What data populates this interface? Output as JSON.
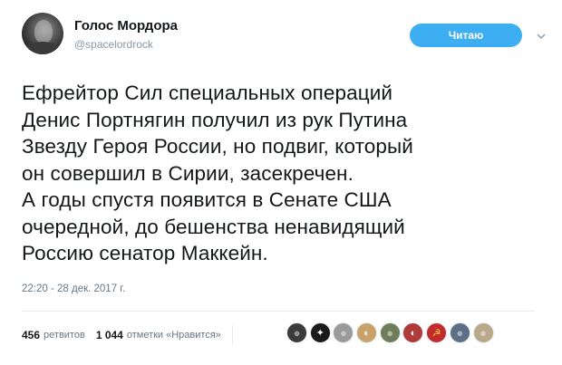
{
  "account": {
    "name": "Голос Мордора",
    "handle": "@spacelordrock",
    "follow_label": "Читаю"
  },
  "tweet": {
    "lines": [
      "Ефрейтор Сил специальных операций",
      "Денис Портнягин получил из рук Путина",
      "Звезду Героя России, но подвиг, который",
      "он совершил в Сирии, засекречен.",
      "А годы спустя появится в Сенате США",
      "очередной, до бешенства ненавидящий",
      "Россию сенатор Маккейн."
    ],
    "timestamp": "22:20 - 28 дек. 2017 г."
  },
  "stats": {
    "retweets_count": "456",
    "retweets_label": "ретвитов",
    "likes_count": "1 044",
    "likes_label": "отметки «Нравится»"
  },
  "liker_avatars": [
    {
      "name": "liker-avatar-1",
      "color": "#3b3b3b",
      "icon": "person-icon"
    },
    {
      "name": "liker-avatar-2",
      "color": "#1a1a1a",
      "icon": "emblem-icon"
    },
    {
      "name": "liker-avatar-3",
      "color": "#9a9a9a",
      "icon": "person-icon"
    },
    {
      "name": "liker-avatar-4",
      "color": "#c8a26a",
      "icon": "portrait-icon"
    },
    {
      "name": "liker-avatar-5",
      "color": "#6e7e5a",
      "icon": "person-icon"
    },
    {
      "name": "liker-avatar-6",
      "color": "#b03a3a",
      "icon": "portrait-icon"
    },
    {
      "name": "liker-avatar-7",
      "color": "#c22b2b",
      "icon": "hammer-sickle-icon"
    },
    {
      "name": "liker-avatar-8",
      "color": "#5c6f86",
      "icon": "person-icon"
    },
    {
      "name": "liker-avatar-9",
      "color": "#b9a889",
      "icon": "person-icon"
    }
  ]
}
